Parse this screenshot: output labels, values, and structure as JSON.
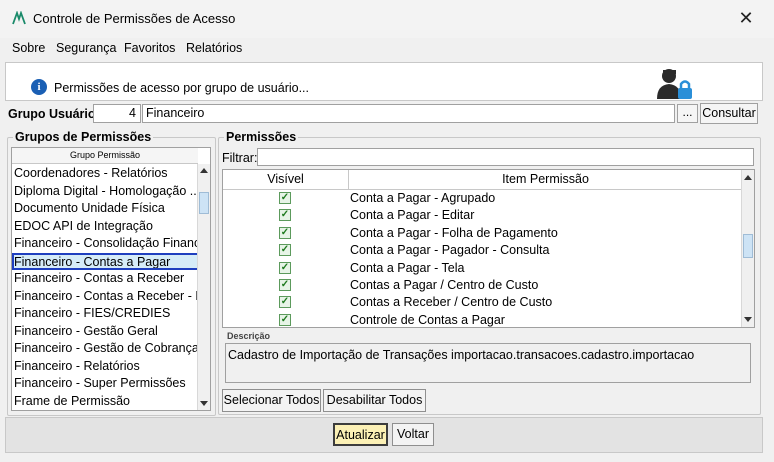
{
  "window": {
    "title": "Controle de Permissões de Acesso",
    "close_glyph": "✕",
    "app_icon": "app-logo-icon"
  },
  "menu": [
    {
      "label": "Sobre"
    },
    {
      "label": "Segurança"
    },
    {
      "label": "Favoritos"
    },
    {
      "label": "Relatórios"
    }
  ],
  "header": {
    "info_glyph": "i",
    "text": "Permissões de acesso por grupo de usuário...",
    "icon": "user-lock-icon"
  },
  "group_user": {
    "label": "Grupo Usuário:",
    "code": "4",
    "name": "Financeiro",
    "ellipsis": "...",
    "consult_label": "Consultar"
  },
  "groups": {
    "legend": "Grupos de Permissões",
    "column_header": "Grupo Permissão",
    "items": [
      "Coordenadores - Relatórios",
      "Diploma Digital - Homologação ...",
      "Documento Unidade Física",
      "EDOC API de Integração",
      "Financeiro - Consolidação Financ...",
      "Financeiro - Contas a Pagar",
      "Financeiro - Contas a Receber",
      "Financeiro - Contas a Receber - R...",
      "Financeiro - FIES/CREDIES",
      "Financeiro - Gestão Geral",
      "Financeiro - Gestão de Cobrança",
      "Financeiro - Relatórios",
      "Financeiro - Super Permissões",
      "Frame de Permissão"
    ],
    "selected": "Financeiro - Contas a Pagar"
  },
  "permissions": {
    "legend": "Permissões",
    "filter_label": "Filtrar:",
    "filter_value": "",
    "columns": [
      "Visível",
      "Item Permissão"
    ],
    "rows": [
      {
        "visible": true,
        "item": "Conta a Pagar - Agrupado"
      },
      {
        "visible": true,
        "item": "Conta a Pagar - Editar"
      },
      {
        "visible": true,
        "item": "Conta a Pagar - Folha de Pagamento"
      },
      {
        "visible": true,
        "item": "Conta a Pagar - Pagador - Consulta"
      },
      {
        "visible": true,
        "item": "Conta a Pagar - Tela"
      },
      {
        "visible": true,
        "item": "Contas a Pagar / Centro de Custo"
      },
      {
        "visible": true,
        "item": "Contas a Receber / Centro de Custo"
      },
      {
        "visible": true,
        "item": "Controle de Contas a Pagar"
      }
    ],
    "check_glyph": "✓",
    "description_label": "Descrição",
    "description": "Cadastro de Importação de Transações importacao.transacoes.cadastro.importacao",
    "select_all_label": "Selecionar Todos",
    "disable_all_label": "Desabilitar Todos"
  },
  "footer": {
    "update_label": "Atualizar",
    "back_label": "Voltar"
  },
  "colors": {
    "selection_border": "#1f3fbf",
    "update_button": "#fbf0b5",
    "check_green": "#1e7a1e",
    "info_blue": "#1a5fb4"
  }
}
